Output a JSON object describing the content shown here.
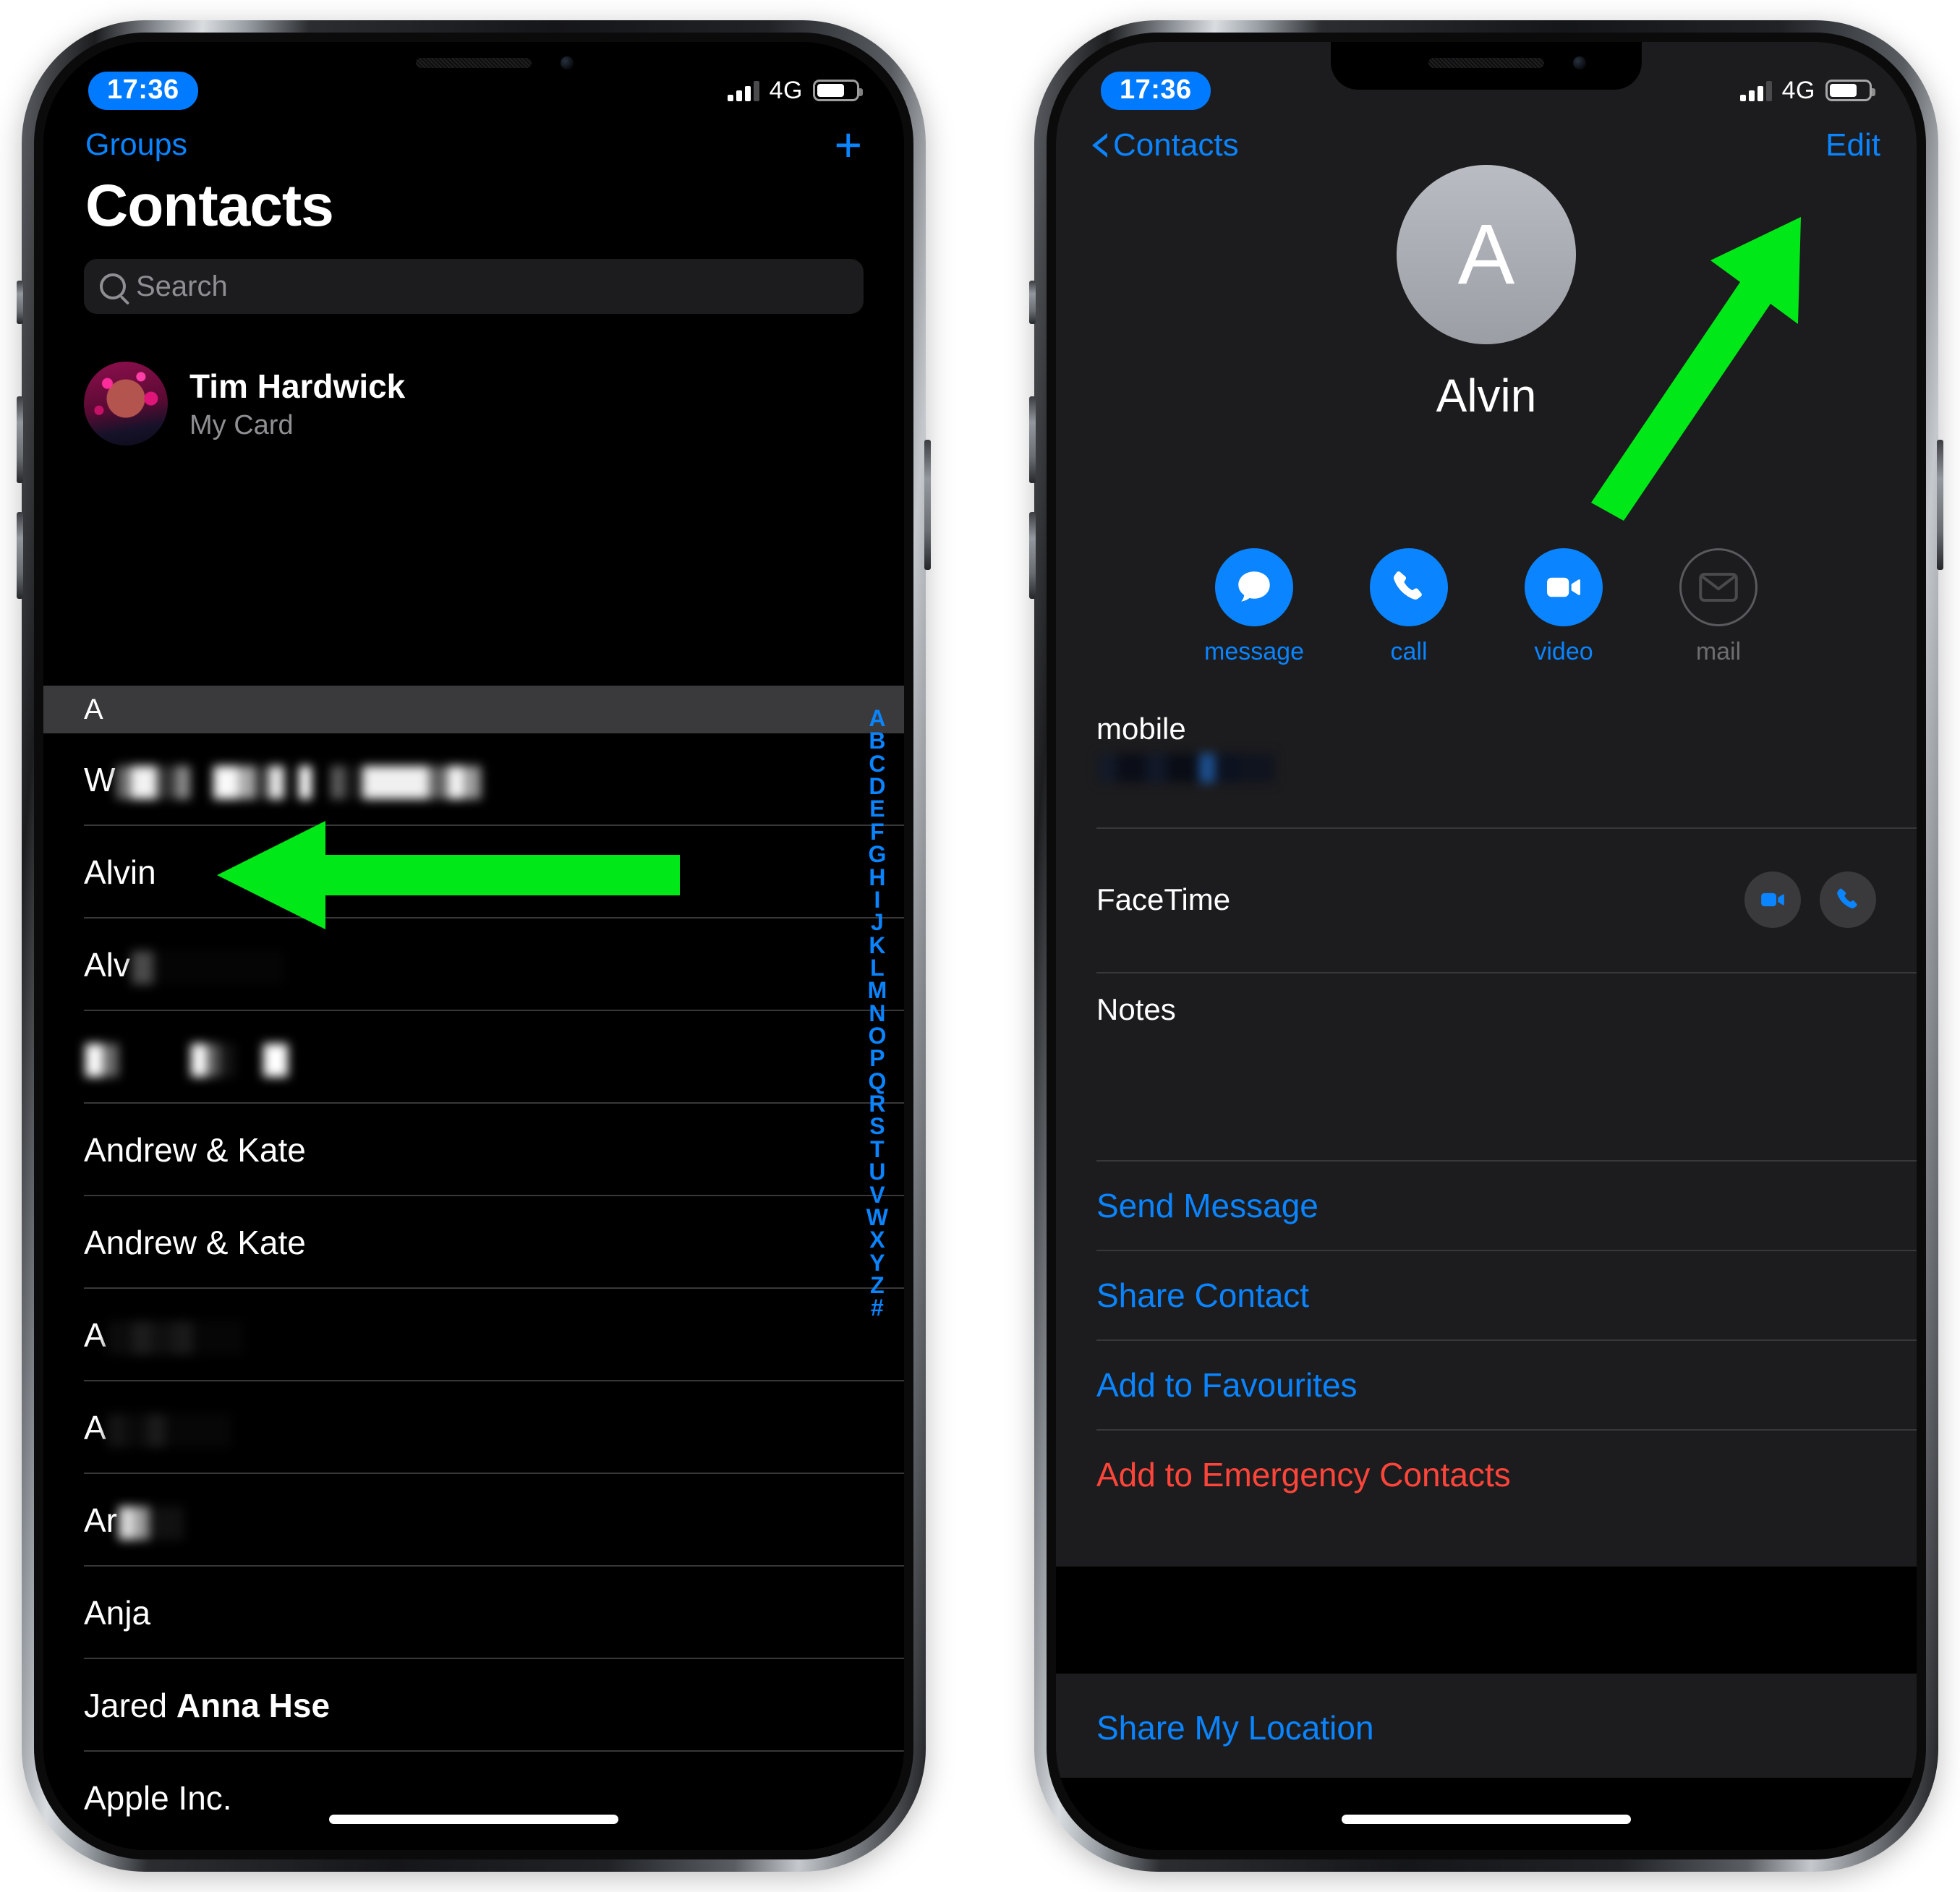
{
  "status_bar": {
    "time": "17:36",
    "network": "4G",
    "signal_bars": 4,
    "signal_filled": 3,
    "battery_percent": 72
  },
  "colors": {
    "accent_blue": "#0a84ff",
    "danger_red": "#ff453a",
    "annotation_green": "#00e818",
    "card_bg": "#1c1c1e",
    "section_header_bg": "#3a3a3c",
    "separator": "#38383a",
    "secondary_text": "#8e8e93"
  },
  "left_screen": {
    "nav": {
      "groups_label": "Groups",
      "add_icon": "plus-icon"
    },
    "title": "Contacts",
    "search": {
      "placeholder": "Search",
      "icon": "search-icon"
    },
    "my_card": {
      "name": "Tim Hardwick",
      "subtitle": "My Card"
    },
    "section_header": "A",
    "contacts": [
      {
        "text": "W",
        "redacted": true,
        "bold": false
      },
      {
        "text": "Alvin",
        "redacted": false,
        "bold": false
      },
      {
        "text": "Alv",
        "redacted": true,
        "bold": false
      },
      {
        "text": "",
        "redacted": true,
        "bold": false
      },
      {
        "text": "Andrew & Kate",
        "redacted": false,
        "bold": false
      },
      {
        "text": "Andrew & Kate",
        "redacted": false,
        "bold": false
      },
      {
        "text": "A",
        "redacted": true,
        "bold": false
      },
      {
        "text": "A",
        "redacted": true,
        "bold": false
      },
      {
        "text": "Ar",
        "redacted": true,
        "bold": false
      },
      {
        "text": "Anja",
        "redacted": false,
        "bold": false
      },
      {
        "text": "Jared Anna Hse",
        "redacted": false,
        "bold": false
      },
      {
        "text": "Apple Inc.",
        "redacted": false,
        "bold": false
      }
    ],
    "index_rail": [
      "A",
      "B",
      "C",
      "D",
      "E",
      "F",
      "G",
      "H",
      "I",
      "J",
      "K",
      "L",
      "M",
      "N",
      "O",
      "P",
      "Q",
      "R",
      "S",
      "T",
      "U",
      "V",
      "W",
      "X",
      "Y",
      "Z",
      "#"
    ]
  },
  "right_screen": {
    "nav": {
      "back_label": "Contacts",
      "back_icon": "chevron-left-icon",
      "edit_label": "Edit"
    },
    "contact": {
      "initial": "A",
      "name": "Alvin"
    },
    "actions": [
      {
        "label": "message",
        "icon": "message-bubble-icon",
        "enabled": true
      },
      {
        "label": "call",
        "icon": "phone-icon",
        "enabled": true
      },
      {
        "label": "video",
        "icon": "video-camera-icon",
        "enabled": true
      },
      {
        "label": "mail",
        "icon": "envelope-icon",
        "enabled": false
      }
    ],
    "fields": [
      {
        "key": "mobile",
        "value_redacted": true
      },
      {
        "key": "FaceTime",
        "value_redacted": false,
        "buttons": [
          "video-camera-icon",
          "phone-icon"
        ]
      },
      {
        "key": "Notes",
        "value_redacted": false
      }
    ],
    "links": [
      {
        "label": "Send Message",
        "style": "blue"
      },
      {
        "label": "Share Contact",
        "style": "blue"
      },
      {
        "label": "Add to Favourites",
        "style": "blue"
      },
      {
        "label": "Add to Emergency Contacts",
        "style": "red"
      }
    ],
    "footer_link": {
      "label": "Share My Location",
      "style": "blue"
    }
  },
  "annotations": [
    {
      "name": "arrow-pointing-to-alvin-row",
      "direction": "left",
      "color": "#00e818"
    },
    {
      "name": "arrow-pointing-to-edit",
      "direction": "up-right",
      "color": "#00e818"
    }
  ]
}
